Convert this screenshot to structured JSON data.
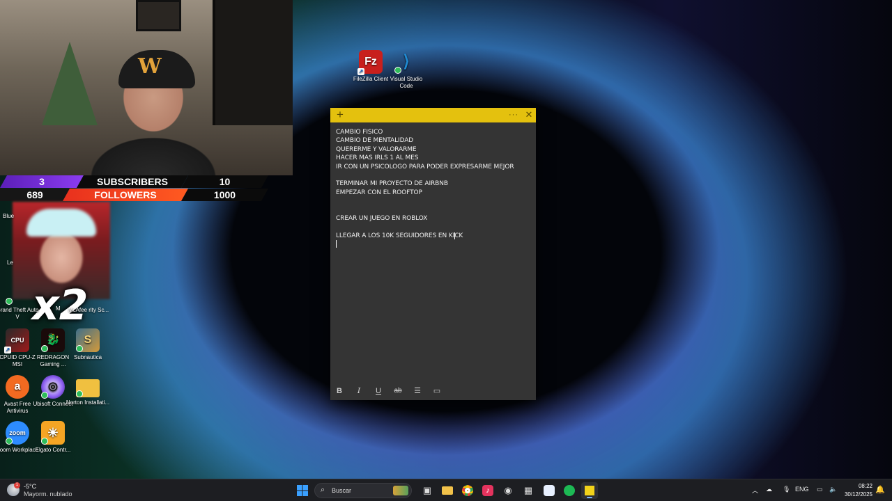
{
  "stream_overlay": {
    "subscribers": {
      "count": "3",
      "label": "SUBSCRIBERS",
      "goal": "10"
    },
    "followers": {
      "count": "689",
      "label": "FOLLOWERS",
      "goal": "1000"
    },
    "multiplier": "x2"
  },
  "desktop": {
    "icons": [
      {
        "id": "filezilla",
        "label": "FileZilla Client",
        "color": "#c8201d",
        "glyph": "Fz"
      },
      {
        "id": "vscode",
        "label": "Visual Studio Code",
        "color": "#1f8ad2",
        "glyph": "≺≻"
      },
      {
        "id": "gta",
        "label": "Grand Theft Auto V"
      },
      {
        "id": "mcafee",
        "label": "McAfee rity Sc..."
      },
      {
        "id": "cpuid",
        "label": "CPUID CPU-Z MSI",
        "glyph": "CPU"
      },
      {
        "id": "redragon",
        "label": "REDRAGON Gaming ...",
        "glyph": "🐉"
      },
      {
        "id": "subnautica",
        "label": "Subnautica",
        "glyph": "S"
      },
      {
        "id": "avast",
        "label": "Avast Free Antivirus",
        "color": "#f26a21",
        "glyph": "a"
      },
      {
        "id": "ubisoft",
        "label": "Ubisoft Connect",
        "glyph": "◎"
      },
      {
        "id": "norton",
        "label": "Norton Installati...",
        "color": "#f0c040"
      },
      {
        "id": "zoom",
        "label": "Zoom Workplace",
        "color": "#2d8cff",
        "glyph": "zoom"
      },
      {
        "id": "elgato",
        "label": "Elgato Contr...",
        "color": "#f5a524",
        "glyph": "☀"
      }
    ],
    "partial_labels": {
      "blue": "Blue",
      "le": "Le",
      "m": "M"
    }
  },
  "sticky_note": {
    "lines": [
      "CAMBIO FISICO",
      "CAMBIO DE MENTALIDAD",
      "QUERERME Y VALORARME",
      "HACER MAS IRLS 1 AL MES",
      "IR CON UN PSICOLOGO PARA PODER EXPRESARME MEJOR",
      "",
      "TERMINAR MI PROYECTO DE AIRBNB",
      "EMPEZAR CON EL ROOFTOP",
      "",
      "",
      "CREAR UN JUEGO EN ROBLOX",
      "",
      "LLEGAR A LOS 10K SEGUIDORES EN KICK"
    ],
    "header_color": "#e4c10e",
    "toolbar": {
      "bold": "B",
      "italic": "I",
      "underline": "U",
      "strike": "ab"
    }
  },
  "taskbar": {
    "weather": {
      "temp": "-5°C",
      "desc": "Mayorm. nublado",
      "badge": "1"
    },
    "search_placeholder": "Buscar",
    "tray": {
      "lang": "ENG"
    },
    "clock": {
      "time": "08:22",
      "date": "30/12/2025"
    }
  }
}
